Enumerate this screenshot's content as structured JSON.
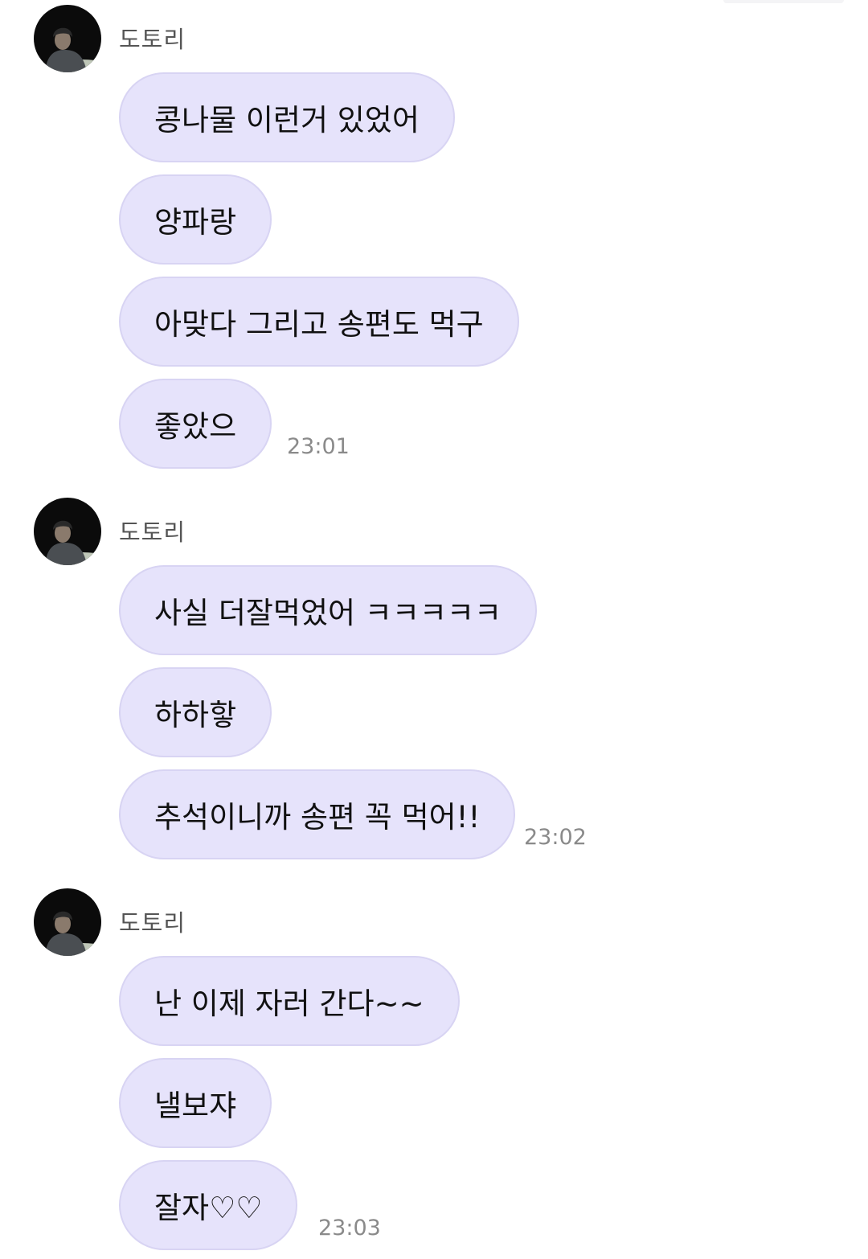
{
  "groups": [
    {
      "sender": "도토리",
      "messages": [
        "콩나물 이런거 있었어",
        "양파랑",
        "아맞다 그리고 송편도 먹구",
        "좋았으"
      ],
      "time": "23:01"
    },
    {
      "sender": "도토리",
      "messages": [
        "사실 더잘먹었어 ㅋㅋㅋㅋㅋ",
        "하하핳",
        "추석이니까 송편 꼭 먹어!!"
      ],
      "time": "23:02"
    },
    {
      "sender": "도토리",
      "messages": [
        "난 이제 자러 간다~~",
        "낼보쟈",
        "잘자♡♡"
      ],
      "time": "23:03"
    }
  ],
  "colors": {
    "bubble": "#e6e3fb",
    "bubble_border": "#d8d4f3",
    "sender": "#555555",
    "time": "#8a8a8a"
  }
}
